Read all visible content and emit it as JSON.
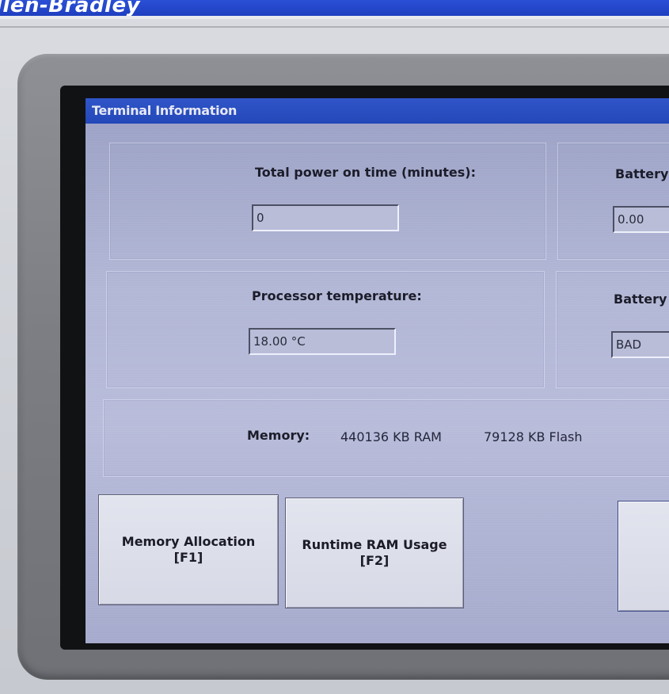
{
  "brand": {
    "text": "llen-Bradley",
    "bar_color": "#2448c8"
  },
  "window": {
    "title": "Terminal Information",
    "title_bar_color": "#2a4fc4",
    "background_color": "#b4b8d6"
  },
  "fields": {
    "power_on_time": {
      "label": "Total power on time (minutes):",
      "value": "0"
    },
    "battery_1": {
      "label": "Battery",
      "value": "0.00"
    },
    "processor_temperature": {
      "label": "Processor temperature:",
      "value": "18.00 °C"
    },
    "battery_2": {
      "label": "Battery",
      "value": "BAD"
    }
  },
  "memory": {
    "label": "Memory:",
    "ram": "440136 KB RAM",
    "flash": "79128 KB Flash"
  },
  "buttons": {
    "memory_allocation": {
      "label": "Memory Allocation",
      "key": "[F1]"
    },
    "runtime_ram_usage": {
      "label": "Runtime RAM Usage",
      "key": "[F2]"
    },
    "third": {
      "label": ""
    }
  }
}
